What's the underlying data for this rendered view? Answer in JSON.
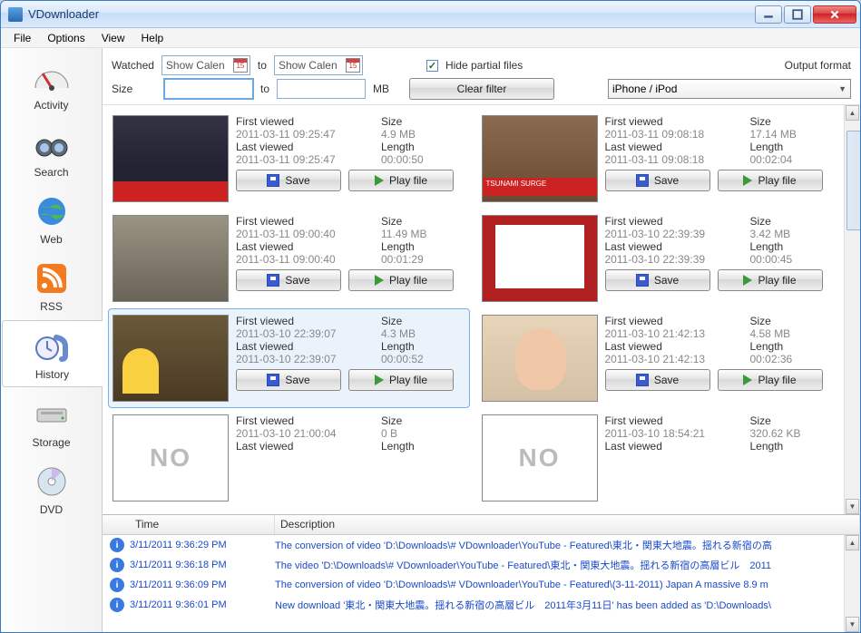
{
  "window": {
    "title": "VDownloader"
  },
  "menu": [
    "File",
    "Options",
    "View",
    "Help"
  ],
  "sidebar": [
    {
      "label": "Activity"
    },
    {
      "label": "Search"
    },
    {
      "label": "Web"
    },
    {
      "label": "RSS"
    },
    {
      "label": "History",
      "selected": true
    },
    {
      "label": "Storage"
    },
    {
      "label": "DVD"
    }
  ],
  "filter": {
    "watched_label": "Watched",
    "watched_from": "Show Calen",
    "watched_to": "Show Calen",
    "to_label": "to",
    "hide_partial_checked": true,
    "hide_partial_label": "Hide partial files",
    "size_label": "Size",
    "size_from": "",
    "size_to": "",
    "mb_label": "MB",
    "clear_label": "Clear filter",
    "output_label": "Output format",
    "output_value": "iPhone / iPod"
  },
  "labels": {
    "first_viewed": "First viewed",
    "last_viewed": "Last viewed",
    "size": "Size",
    "length": "Length",
    "save": "Save",
    "play": "Play file",
    "noimg": "NO"
  },
  "videos": [
    {
      "thumb": "th-news",
      "first": "2011-03-11 09:25:47",
      "last": "2011-03-11 09:25:47",
      "size": "4.9 MB",
      "length": "00:00:50"
    },
    {
      "thumb": "th-rt",
      "first": "2011-03-11 09:08:18",
      "last": "2011-03-11 09:08:18",
      "size": "17.14 MB",
      "length": "00:02:04"
    },
    {
      "thumb": "th-cam",
      "first": "2011-03-11 09:00:40",
      "last": "2011-03-11 09:00:40",
      "size": "11.49 MB",
      "length": "00:01:29"
    },
    {
      "thumb": "th-yt",
      "first": "2011-03-10 22:39:39",
      "last": "2011-03-10 22:39:39",
      "size": "3.42 MB",
      "length": "00:00:45"
    },
    {
      "thumb": "th-simpsons",
      "first": "2011-03-10 22:39:07",
      "last": "2011-03-10 22:39:07",
      "size": "4.3 MB",
      "length": "00:00:52",
      "selected": true
    },
    {
      "thumb": "th-girl",
      "first": "2011-03-10 21:42:13",
      "last": "2011-03-10 21:42:13",
      "size": "4.58 MB",
      "length": "00:02:36"
    },
    {
      "thumb": "noimg",
      "first": "2011-03-10 21:00:04",
      "last": "",
      "size": "0 B",
      "length": "",
      "partial": true
    },
    {
      "thumb": "noimg",
      "first": "2011-03-10 18:54:21",
      "last": "",
      "size": "320.62 KB",
      "length": "",
      "partial": true
    }
  ],
  "log": {
    "headers": [
      "Time",
      "Description"
    ],
    "rows": [
      {
        "time": "3/11/2011 9:36:29 PM",
        "desc": "The conversion of video 'D:\\Downloads\\# VDownloader\\YouTube - Featured\\東北・関東大地震。揺れる新宿の高"
      },
      {
        "time": "3/11/2011 9:36:18 PM",
        "desc": "The video 'D:\\Downloads\\# VDownloader\\YouTube - Featured\\東北・関東大地震。揺れる新宿の高層ビル　2011"
      },
      {
        "time": "3/11/2011 9:36:09 PM",
        "desc": "The conversion of video 'D:\\Downloads\\# VDownloader\\YouTube - Featured\\(3-11-2011) Japan   A massive 8.9 m"
      },
      {
        "time": "3/11/2011 9:36:01 PM",
        "desc": "New download '東北・関東大地震。揺れる新宿の高層ビル　2011年3月11日' has been added as 'D:\\Downloads\\"
      }
    ]
  }
}
